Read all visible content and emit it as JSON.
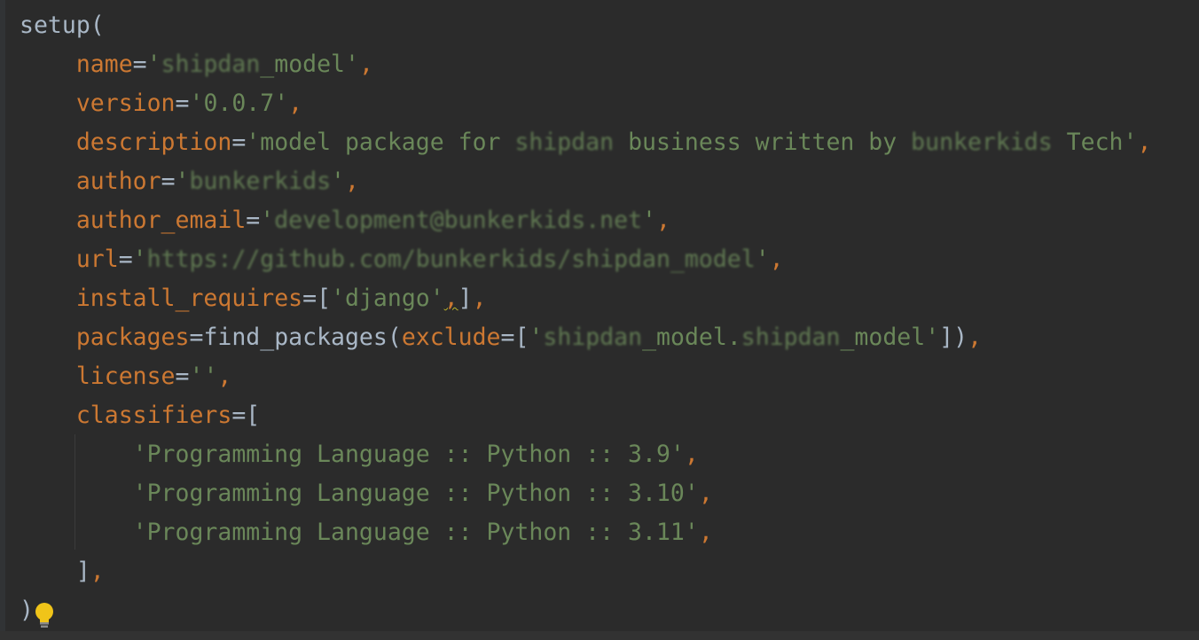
{
  "code": {
    "l0": {
      "t": "setup("
    },
    "l1": {
      "kw": "name",
      "eq": "=",
      "q1": "'",
      "blur": "shipdan",
      "rest": "_model'",
      "end": ","
    },
    "l2": {
      "kw": "version",
      "eq": "=",
      "str": "'0.0.7'",
      "end": ","
    },
    "l3": {
      "kw": "description",
      "eq": "=",
      "s1": "'model package for ",
      "b1": "shipdan",
      "s2": " business written by ",
      "b2": "bunkerkids",
      "s3": " Tech'",
      "end": ","
    },
    "l4": {
      "kw": "author",
      "eq": "=",
      "q1": "'",
      "blur": "bunkerkids",
      "q2": "'",
      "end": ","
    },
    "l5": {
      "kw": "author_email",
      "eq": "=",
      "q1": "'",
      "blur": "development@bunkerkids.net",
      "q2": "'",
      "end": ","
    },
    "l6": {
      "kw": "url",
      "eq": "=",
      "q1": "'",
      "blur": "https://github.com/bunkerkids/shipdan_model",
      "q2": "'",
      "end": ","
    },
    "l7": {
      "kw": "install_requires",
      "eq": "=",
      "open": "[",
      "str": "'django'",
      "comma": ",",
      "close": "]",
      "end": ","
    },
    "l8": {
      "kw": "packages",
      "eq": "=",
      "fn": "find_packages(",
      "kw2": "exclude",
      "eq2": "=",
      "open": "[",
      "q1": "'",
      "b1": "shipdan",
      "s1": "_model.",
      "b2": "shipdan",
      "s2": "_model'",
      "close": "])",
      "end": ","
    },
    "l9": {
      "kw": "license",
      "eq": "=",
      "str": "''",
      "end": ","
    },
    "l10": {
      "kw": "classifiers",
      "eq": "=",
      "open": "["
    },
    "l11": {
      "str": "'Programming Language :: Python :: 3.9'",
      "end": ","
    },
    "l12": {
      "str": "'Programming Language :: Python :: 3.10'",
      "end": ","
    },
    "l13": {
      "str": "'Programming Language :: Python :: 3.11'",
      "end": ","
    },
    "l14": {
      "close": "]",
      "end": ","
    },
    "l15": {
      "t": ")"
    }
  },
  "icons": {
    "bulb": "lightbulb-icon"
  },
  "colors": {
    "background": "#2b2b2b",
    "keyword": "#cc7832",
    "string": "#6a8759",
    "text": "#a9b7c6",
    "bulb": "#f0c419"
  }
}
